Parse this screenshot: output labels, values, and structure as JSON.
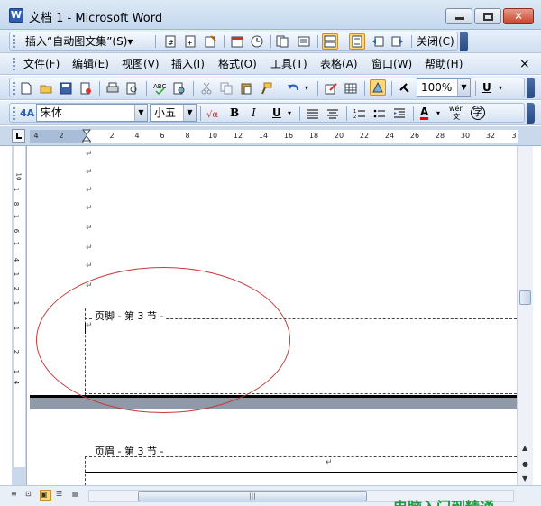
{
  "window": {
    "title": "文档 1 - Microsoft Word",
    "app_icon": "W",
    "controls": {
      "minimize": "minimize-icon",
      "maximize": "maximize-icon",
      "close": "✕"
    }
  },
  "header_footer_toolbar": {
    "insert_autotext_label": "插入“自动图文集”(S)▾",
    "close_label": "关闭(C)"
  },
  "menu": {
    "items": [
      "文件(F)",
      "编辑(E)",
      "视图(V)",
      "插入(I)",
      "格式(O)",
      "工具(T)",
      "表格(A)",
      "窗口(W)",
      "帮助(H)"
    ],
    "close_glyph": "×"
  },
  "standard_toolbar": {
    "zoom": "100%"
  },
  "formatting_toolbar": {
    "style_icon": "4A",
    "font_name": "宋体",
    "font_size": "小五",
    "bold": "B",
    "italic": "I",
    "underline": "U",
    "font_color": "A",
    "phonetic": "wén",
    "enclose": "字"
  },
  "ruler": {
    "ticks": [
      "4",
      "2",
      "",
      "2",
      "4",
      "6",
      "8",
      "10",
      "12",
      "14",
      "16",
      "18",
      "20",
      "22",
      "24",
      "26",
      "28",
      "30",
      "32",
      "3"
    ],
    "vticks": [
      "10",
      "1",
      "8",
      "1",
      "6",
      "1",
      "4",
      "1",
      "2",
      "1",
      "1",
      "2",
      "1",
      "4"
    ]
  },
  "document": {
    "paragraph_mark": "↵",
    "footer_label": "页脚 - 第 3 节 -",
    "header_label": "页眉 - 第 3 节 -"
  },
  "watermark": "电脑入门到精通"
}
